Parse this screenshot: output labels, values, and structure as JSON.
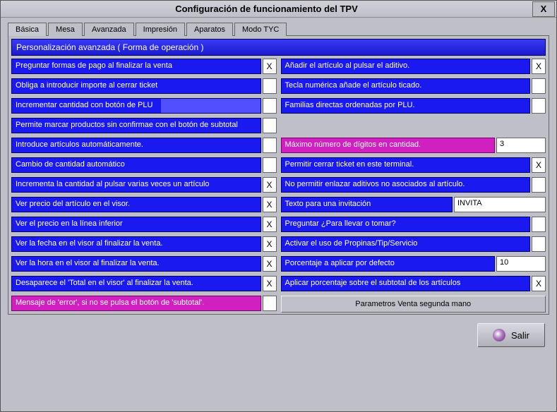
{
  "window": {
    "title": "Configuración de funcionamiento del TPV",
    "close": "X"
  },
  "tabs": [
    "Básica",
    "Mesa",
    "Avanzada",
    "Impresión",
    "Aparatos",
    "Modo TYC"
  ],
  "active_tab": 0,
  "section_header": "Personalización avanzada ( Forma de operación )",
  "left": [
    {
      "label": "Preguntar formas de pago al finalizar la venta",
      "check": "X"
    },
    {
      "label": "Obliga a introducir importe al cerrar ticket",
      "check": ""
    },
    {
      "label": "Incrementar cantidad con botón de PLU",
      "check": "",
      "style": "halfblue"
    },
    {
      "label": "Permite marcar productos sin confirmae con el botón de subtotal",
      "check": ""
    },
    {
      "label": "Introduce artículos automáticamente.",
      "check": ""
    },
    {
      "label": "Cambio de cantidad automático",
      "check": ""
    },
    {
      "label": "Incrementa la cantidad al pulsar varias veces un artículo",
      "check": "X"
    },
    {
      "label": "Ver precio del artículo en el visor.",
      "check": "X"
    },
    {
      "label": "Ver el precio en la línea inferior",
      "check": "X"
    },
    {
      "label": "Ver la  fecha en el visor al finalizar la venta.",
      "check": "X"
    },
    {
      "label": "Ver la hora en el visor al finalizar la venta.",
      "check": "X"
    },
    {
      "label": "Desaparece el 'Total en el visor' al finalizar la venta.",
      "check": "X"
    },
    {
      "label": "Mensaje de 'error', si no se pulsa el botón de 'subtotal'.",
      "check": "",
      "style": "magenta"
    }
  ],
  "right": [
    {
      "type": "check",
      "label": "Añadir el artículo al pulsar el aditivo.",
      "check": "X"
    },
    {
      "type": "check",
      "label": "Tecla numérica añade el artículo ticado.",
      "check": ""
    },
    {
      "type": "check",
      "label": "Familias directas ordenadas por PLU.",
      "check": ""
    },
    {
      "type": "spacer"
    },
    {
      "type": "text",
      "label": "Máximo número de dígitos en cantidad.",
      "value": "3",
      "style": "magenta"
    },
    {
      "type": "check",
      "label": "Permitir cerrar ticket en este terminal.",
      "check": "X"
    },
    {
      "type": "check",
      "label": "No permitir enlazar aditivos no asociados al artículo.",
      "check": ""
    },
    {
      "type": "text",
      "label": "Texto para una invitación",
      "value": "INVITA",
      "wide": true
    },
    {
      "type": "check",
      "label": "Preguntar ¿Para llevar o tomar?",
      "check": ""
    },
    {
      "type": "check",
      "label": "Activar el uso de Propinas/Tip/Servicio",
      "check": ""
    },
    {
      "type": "text",
      "label": "Porcentaje a aplicar por defecto",
      "value": "10"
    },
    {
      "type": "check",
      "label": "Aplicar porcentaje sobre el subtotal de los artículos",
      "check": "X"
    },
    {
      "type": "button",
      "label": "Parametros Venta segunda mano"
    }
  ],
  "footer": {
    "exit": "Salir"
  }
}
